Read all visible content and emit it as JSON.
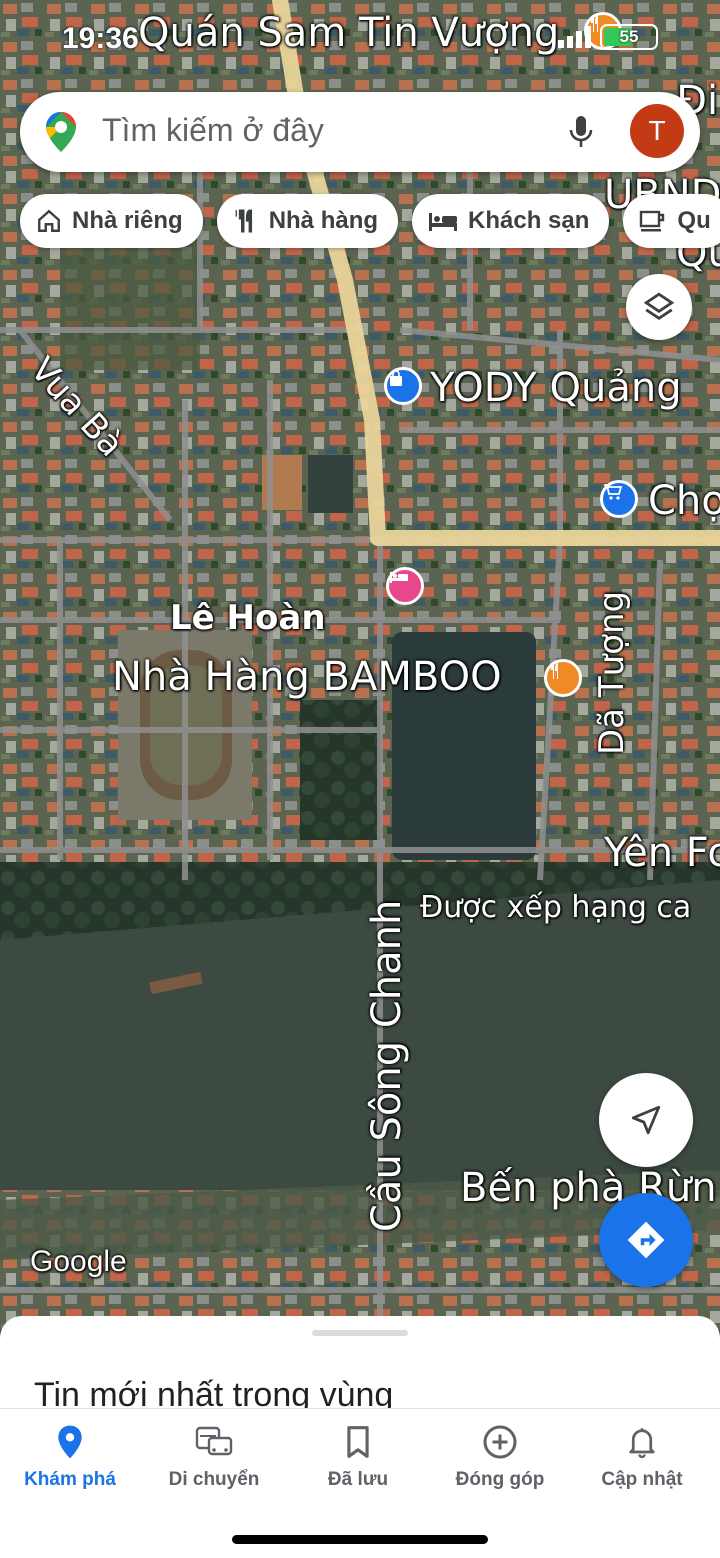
{
  "status_bar": {
    "time": "19:36",
    "battery": "55"
  },
  "search": {
    "placeholder": "Tìm kiếm ở đây",
    "avatar_letter": "T"
  },
  "chips": [
    {
      "label": "Nhà riêng",
      "icon": "home-icon"
    },
    {
      "label": "Nhà hàng",
      "icon": "restaurant-icon"
    },
    {
      "label": "Khách sạn",
      "icon": "hotel-icon"
    },
    {
      "label": "Qu",
      "icon": "cafe-icon"
    }
  ],
  "map_labels": {
    "quan_sam": "Quán Sam Tin Vượng",
    "ubnd_1": "Đi",
    "ubnd_2": "UBND",
    "ubnd_3": "Qu",
    "vua_ba": "Vua Bà",
    "yody": "YODY Quảng",
    "cho": "Chợ",
    "le_hoan": "Lê Hoàn",
    "bamboo": "Nhà Hàng BAMBOO",
    "da_tuong": "Dã Tượng",
    "yen_fo": "Yên Fo",
    "duoc_xep": "Được xếp hạng ca",
    "cau_song_chanh": "Cầu Sông Chanh",
    "ben_pha": "Bến phà Rừn",
    "google": "Google"
  },
  "sheet": {
    "title": "Tin mới nhất trong vùng"
  },
  "nav": [
    {
      "label": "Khám phá",
      "icon": "explore-pin-icon",
      "active": true
    },
    {
      "label": "Di chuyển",
      "icon": "commute-icon",
      "active": false
    },
    {
      "label": "Đã lưu",
      "icon": "bookmark-icon",
      "active": false
    },
    {
      "label": "Đóng góp",
      "icon": "add-circle-icon",
      "active": false
    },
    {
      "label": "Cập nhật",
      "icon": "bell-icon",
      "active": false
    }
  ],
  "colors": {
    "accent": "#1a73e8",
    "avatar": "#c23b14",
    "food_pin": "#f08a24",
    "hotel_pin": "#e8478b",
    "shop_pin": "#1a73e8"
  }
}
